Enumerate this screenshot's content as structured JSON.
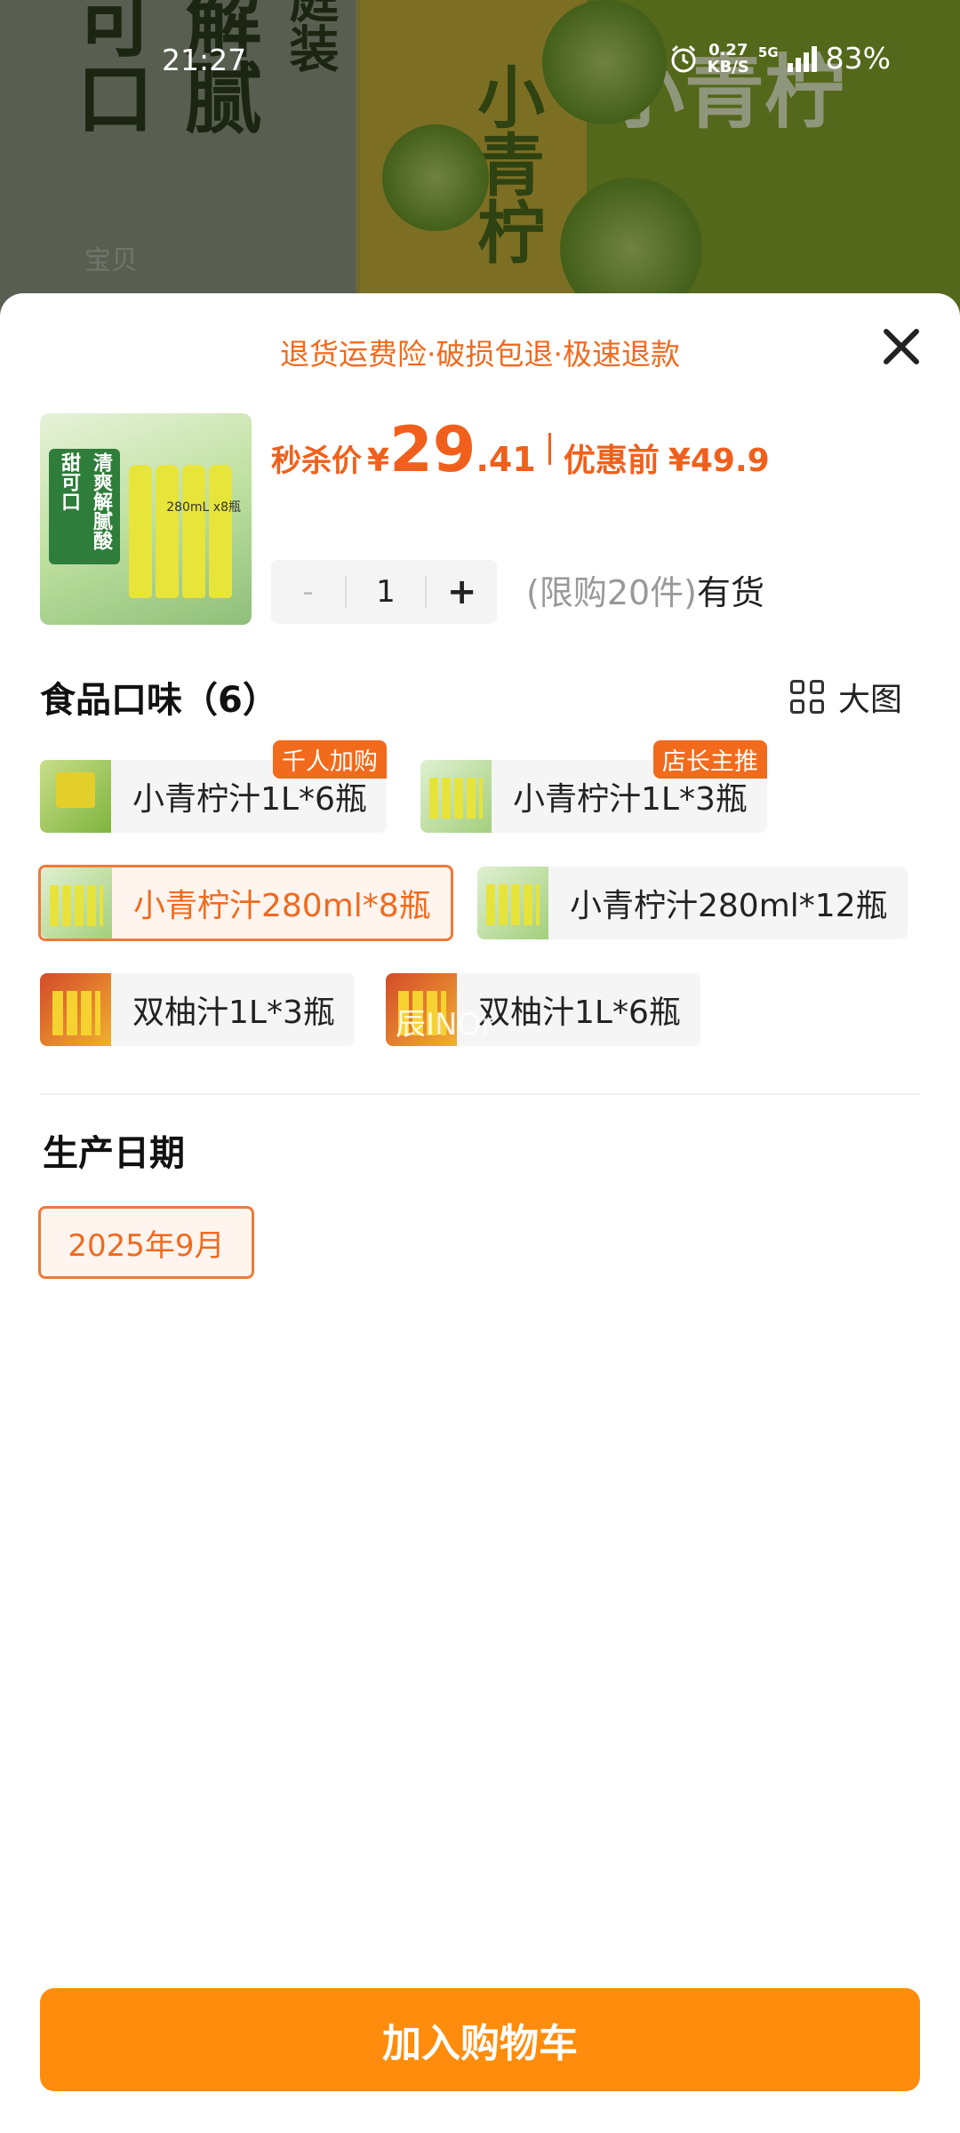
{
  "status_bar": {
    "time": "21:27",
    "net_speed_value": "0.27",
    "net_speed_unit": "KB/S",
    "net_type": "5G",
    "battery": "83%"
  },
  "background": {
    "brand_text_1": "可口",
    "brand_text_2": "解腻",
    "brand_text_3": "庭装",
    "product_box_text": "小青柠",
    "ghost_text": "宝贝"
  },
  "sheet": {
    "guarantee": "退货运费险·破损包退·极速退款",
    "product_thumb": {
      "badge": "清爽解腻酸甜可口",
      "label": "280mL x8瓶"
    },
    "price": {
      "label": "秒杀价",
      "currency": "¥",
      "integer": "29",
      "decimal": ".41",
      "before_label": "优惠前",
      "before_price": "¥49.9"
    },
    "quantity": {
      "minus": "-",
      "value": "1",
      "plus": "+"
    },
    "limit_text": "(限购20件)",
    "stock_text": "有货",
    "flavor_section": {
      "title": "食品口味（6）",
      "big_view_label": "大图",
      "options": [
        {
          "label": "小青柠汁1L*6瓶",
          "tag": "千人加购",
          "selected": false
        },
        {
          "label": "小青柠汁1L*3瓶",
          "tag": "店长主推",
          "selected": false
        },
        {
          "label": "小青柠汁280ml*8瓶",
          "tag": "",
          "selected": true
        },
        {
          "label": "小青柠汁280ml*12瓶",
          "tag": "",
          "selected": false
        },
        {
          "label": "双柚汁1L*3瓶",
          "tag": "",
          "selected": false
        },
        {
          "label": "双柚汁1L*6瓶",
          "tag": "",
          "selected": false
        }
      ],
      "watermark": "辰INOr"
    },
    "date_section": {
      "title": "生产日期",
      "selected_date": "2025年9月"
    },
    "add_to_cart": "加入购物车"
  },
  "colors": {
    "accent": "#f06a1e",
    "cart_button": "#ff8c0c",
    "tag_bg": "#f26a1c"
  }
}
